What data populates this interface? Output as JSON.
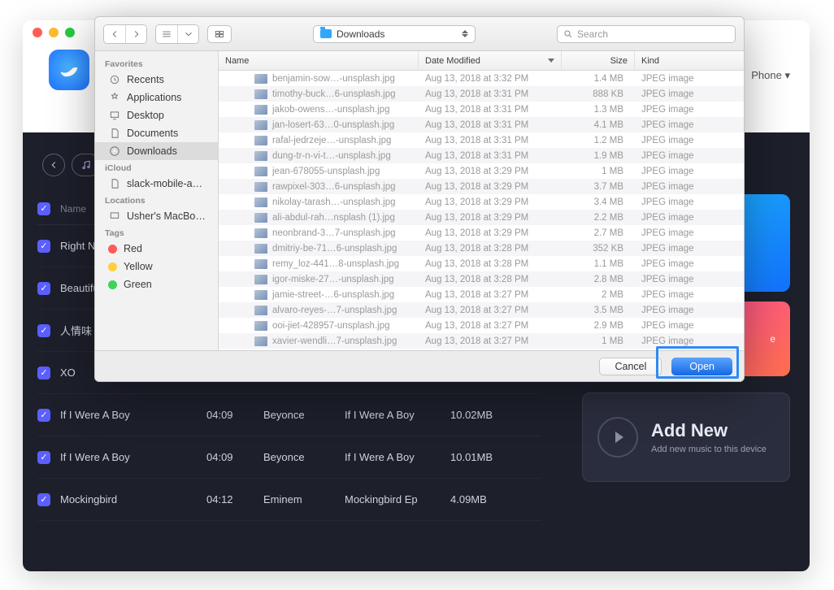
{
  "app": {
    "phone_selector": "Phone  ▾"
  },
  "tracks": {
    "header": {
      "name": "Name"
    },
    "rows": [
      {
        "name": "Right Nov"
      },
      {
        "name": "Beautiful"
      },
      {
        "name": "人情味 (ノ"
      },
      {
        "name": "XO"
      },
      {
        "name": "If I Were A Boy",
        "time": "04:09",
        "artist": "Beyonce",
        "album": "If I Were A Boy",
        "size": "10.02MB"
      },
      {
        "name": "If I Were A Boy",
        "time": "04:09",
        "artist": "Beyonce",
        "album": "If I Were A Boy",
        "size": "10.01MB"
      },
      {
        "name": "Mockingbird",
        "time": "04:12",
        "artist": "Eminem",
        "album": "Mockingbird Ep",
        "size": "4.09MB"
      }
    ]
  },
  "addnew": {
    "title": "Add New",
    "subtitle": "Add new music to this device"
  },
  "pink_card": {
    "label": "e"
  },
  "dialog": {
    "path_label": "Downloads",
    "search_placeholder": "Search",
    "cancel": "Cancel",
    "open": "Open",
    "sidebar": {
      "favorites_head": "Favorites",
      "favorites": [
        "Recents",
        "Applications",
        "Desktop",
        "Documents",
        "Downloads"
      ],
      "icloud_head": "iCloud",
      "icloud": [
        "slack-mobile-a…"
      ],
      "locations_head": "Locations",
      "locations": [
        "Usher's MacBo…"
      ],
      "tags_head": "Tags",
      "tags": [
        {
          "label": "Red",
          "color": "#ff5b5b"
        },
        {
          "label": "Yellow",
          "color": "#ffcf3f"
        },
        {
          "label": "Green",
          "color": "#41d159"
        }
      ]
    },
    "columns": {
      "name": "Name",
      "date": "Date Modified",
      "size": "Size",
      "kind": "Kind"
    },
    "files": [
      {
        "name": "benjamin-sow…-unsplash.jpg",
        "date": "Aug 13, 2018 at 3:32 PM",
        "size": "1.4 MB",
        "kind": "JPEG image"
      },
      {
        "name": "timothy-buck…6-unsplash.jpg",
        "date": "Aug 13, 2018 at 3:31 PM",
        "size": "888 KB",
        "kind": "JPEG image"
      },
      {
        "name": "jakob-owens…-unsplash.jpg",
        "date": "Aug 13, 2018 at 3:31 PM",
        "size": "1.3 MB",
        "kind": "JPEG image"
      },
      {
        "name": "jan-losert-63…0-unsplash.jpg",
        "date": "Aug 13, 2018 at 3:31 PM",
        "size": "4.1 MB",
        "kind": "JPEG image"
      },
      {
        "name": "rafal-jedrzeje…-unsplash.jpg",
        "date": "Aug 13, 2018 at 3:31 PM",
        "size": "1.2 MB",
        "kind": "JPEG image"
      },
      {
        "name": "dung-tr-n-vi-t…-unsplash.jpg",
        "date": "Aug 13, 2018 at 3:31 PM",
        "size": "1.9 MB",
        "kind": "JPEG image"
      },
      {
        "name": "jean-678055-unsplash.jpg",
        "date": "Aug 13, 2018 at 3:29 PM",
        "size": "1 MB",
        "kind": "JPEG image"
      },
      {
        "name": "rawpixel-303…6-unsplash.jpg",
        "date": "Aug 13, 2018 at 3:29 PM",
        "size": "3.7 MB",
        "kind": "JPEG image"
      },
      {
        "name": "nikolay-tarash…-unsplash.jpg",
        "date": "Aug 13, 2018 at 3:29 PM",
        "size": "3.4 MB",
        "kind": "JPEG image"
      },
      {
        "name": "ali-abdul-rah…nsplash (1).jpg",
        "date": "Aug 13, 2018 at 3:29 PM",
        "size": "2.2 MB",
        "kind": "JPEG image"
      },
      {
        "name": "neonbrand-3…7-unsplash.jpg",
        "date": "Aug 13, 2018 at 3:29 PM",
        "size": "2.7 MB",
        "kind": "JPEG image"
      },
      {
        "name": "dmitriy-be-71…6-unsplash.jpg",
        "date": "Aug 13, 2018 at 3:28 PM",
        "size": "352 KB",
        "kind": "JPEG image"
      },
      {
        "name": "remy_loz-441…8-unsplash.jpg",
        "date": "Aug 13, 2018 at 3:28 PM",
        "size": "1.1 MB",
        "kind": "JPEG image"
      },
      {
        "name": "igor-miske-27…-unsplash.jpg",
        "date": "Aug 13, 2018 at 3:28 PM",
        "size": "2.8 MB",
        "kind": "JPEG image"
      },
      {
        "name": "jamie-street-…6-unsplash.jpg",
        "date": "Aug 13, 2018 at 3:27 PM",
        "size": "2 MB",
        "kind": "JPEG image"
      },
      {
        "name": "alvaro-reyes-…7-unsplash.jpg",
        "date": "Aug 13, 2018 at 3:27 PM",
        "size": "3.5 MB",
        "kind": "JPEG image"
      },
      {
        "name": "ooi-jiet-428957-unsplash.jpg",
        "date": "Aug 13, 2018 at 3:27 PM",
        "size": "2.9 MB",
        "kind": "JPEG image"
      },
      {
        "name": "xavier-wendli…7-unsplash.jpg",
        "date": "Aug 13, 2018 at 3:27 PM",
        "size": "1 MB",
        "kind": "JPEG image"
      }
    ]
  }
}
